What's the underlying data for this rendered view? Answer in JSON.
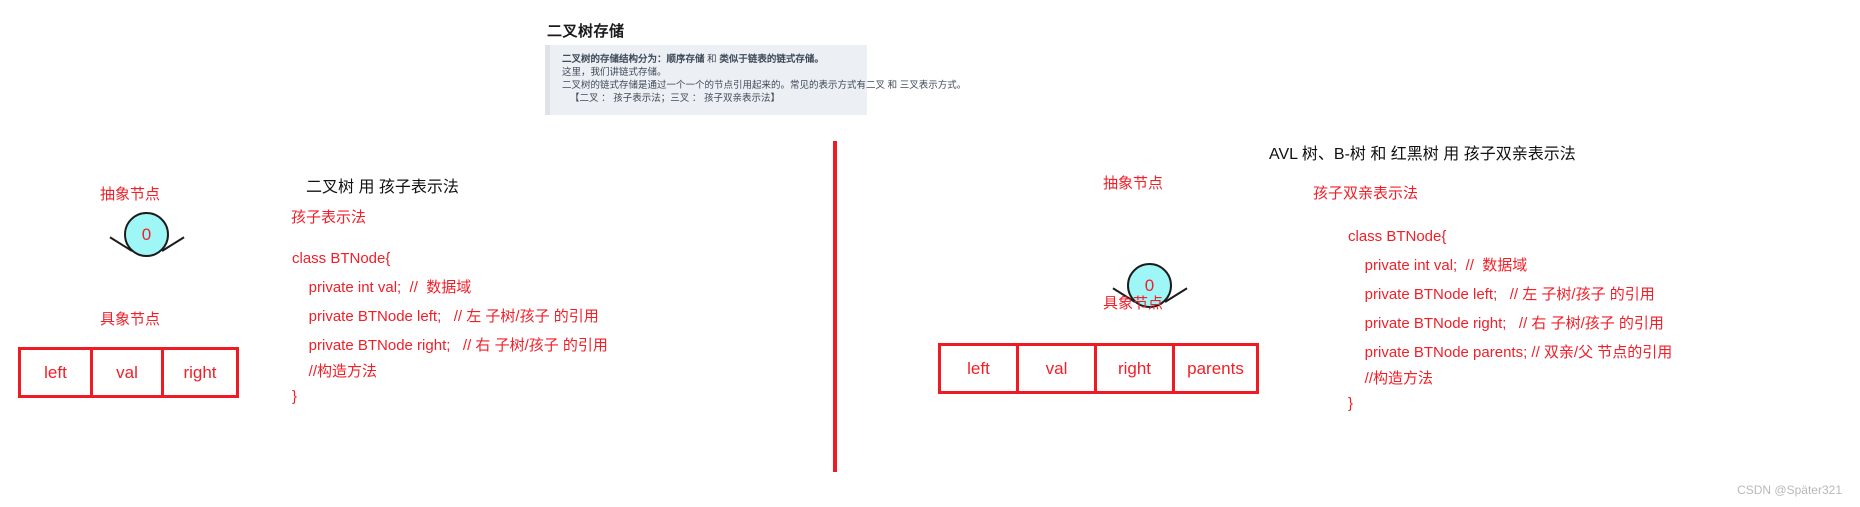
{
  "document": {
    "heading": "二叉树存储",
    "note": {
      "line1_a": "二叉树的存储结构分为：",
      "line1_b": "顺序存储",
      "line1_c": " 和 ",
      "line1_d": "类似于链表的链式存储。",
      "line2": "这里，我们讲链式存储。",
      "line3": "二叉树的链式存储是通过一个一个的节点引用起来的。常见的表示方式有二叉 和 三叉表示方式。",
      "line4": "【二叉 ： 孩子表示法；三叉 ： 孩子双亲表示法】"
    }
  },
  "left_panel": {
    "abstract_label": "抽象节点",
    "concrete_label": "具象节点",
    "node_value": "0",
    "table_cells": [
      "left",
      "val",
      "right"
    ],
    "code": {
      "title": "二叉树 用 孩子表示法",
      "subtitle": "孩子表示法",
      "lines": [
        "class BTNode{",
        "    private int val;  //  数据域",
        "    private BTNode left;   // 左 子树/孩子 的引用",
        "    private BTNode right;   // 右 子树/孩子 的引用",
        "    //构造方法",
        "}"
      ]
    }
  },
  "right_panel": {
    "abstract_label": "抽象节点",
    "concrete_label": "具象节点",
    "node_value": "0",
    "table_cells": [
      "left",
      "val",
      "right",
      "parents"
    ],
    "code": {
      "title": "AVL 树、B-树 和 红黑树 用 孩子双亲表示法",
      "subtitle": "孩子双亲表示法",
      "lines": [
        "class BTNode{",
        "    private int val;  //  数据域",
        "    private BTNode left;   // 左 子树/孩子 的引用",
        "    private BTNode right;   // 右 子树/孩子 的引用",
        "    private BTNode parents; // 双亲/父 节点的引用",
        "    //构造方法",
        "}"
      ]
    }
  },
  "watermark": "CSDN @Später321",
  "colors": {
    "accent_red": "#ee1b24",
    "text_red": "#f01f28",
    "node_fill": "#9ff6f6",
    "note_bg": "#eceff3",
    "watermark": "#b9b9b9"
  }
}
